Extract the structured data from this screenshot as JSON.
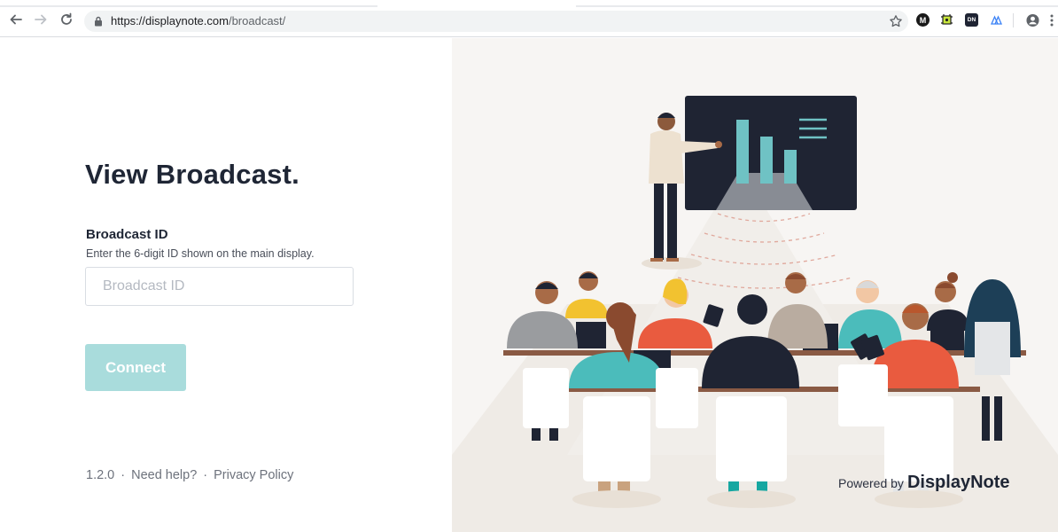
{
  "browser": {
    "url_host": "https://displaynote.com",
    "url_path": "/broadcast/"
  },
  "page": {
    "title": "View Broadcast.",
    "field_label": "Broadcast ID",
    "field_help": "Enter the 6-digit ID shown on the main display.",
    "input_placeholder": "Broadcast ID",
    "input_value": "",
    "connect_label": "Connect"
  },
  "footer": {
    "version": "1.2.0",
    "sep": "·",
    "help": "Need help?",
    "privacy": "Privacy Policy"
  },
  "branding": {
    "powered_by": "Powered by",
    "brand": "DisplayNote"
  },
  "extensions": {
    "ext1": "M",
    "ext3": "DN"
  },
  "colors": {
    "accent": "#a9dcdc",
    "title": "#1f2635",
    "screen": "#1f2433",
    "bar": "#6fc2c4"
  }
}
